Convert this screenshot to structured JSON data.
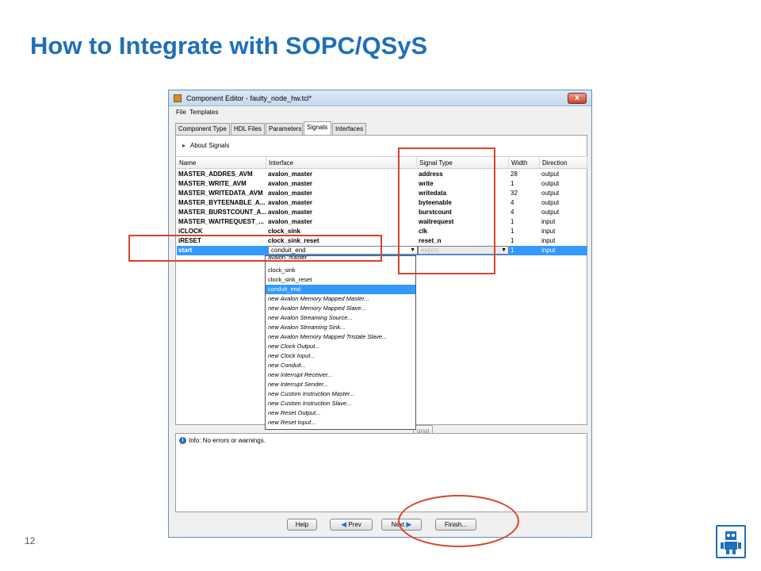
{
  "slide": {
    "title": "How to Integrate with SOPC/QSyS",
    "page_number": "12",
    "annotation_color": "#d6452c",
    "title_color": "#1f6fb8"
  },
  "window": {
    "title": "Component Editor - faulty_node_hw.tcl*",
    "close_glyph": "x",
    "menu": [
      "File",
      "Templates"
    ],
    "tabs": [
      "Component Type",
      "HDL Files",
      "Parameters",
      "Signals",
      "Interfaces"
    ],
    "active_tab": "Signals",
    "about_label": "About Signals",
    "columns": [
      "Name",
      "Interface",
      "Signal Type",
      "Width",
      "Direction"
    ],
    "rows": [
      {
        "name": "MASTER_ADDRES_AVM",
        "interface": "avalon_master",
        "signal_type": "address",
        "width": "28",
        "direction": "output"
      },
      {
        "name": "MASTER_WRITE_AVM",
        "interface": "avalon_master",
        "signal_type": "write",
        "width": "1",
        "direction": "output"
      },
      {
        "name": "MASTER_WRITEDATA_AVM",
        "interface": "avalon_master",
        "signal_type": "writedata",
        "width": "32",
        "direction": "output"
      },
      {
        "name": "MASTER_BYTEENABLE_A...",
        "interface": "avalon_master",
        "signal_type": "byteenable",
        "width": "4",
        "direction": "output"
      },
      {
        "name": "MASTER_BURSTCOUNT_A...",
        "interface": "avalon_master",
        "signal_type": "burstcount",
        "width": "4",
        "direction": "output"
      },
      {
        "name": "MASTER_WAITREQUEST_...",
        "interface": "avalon_master",
        "signal_type": "waitrequest",
        "width": "1",
        "direction": "input"
      },
      {
        "name": "iCLOCK",
        "interface": "clock_sink",
        "signal_type": "clk",
        "width": "1",
        "direction": "input"
      },
      {
        "name": "iRESET",
        "interface": "clock_sink_reset",
        "signal_type": "reset_n",
        "width": "1",
        "direction": "input"
      }
    ],
    "selected_row": {
      "name": "start",
      "interface": "conduit_end",
      "signal_type": "export",
      "width": "1",
      "direction": "input"
    },
    "dropdown_options": [
      "avalon_master",
      "clock_sink",
      "clock_sink_reset",
      "conduit_end",
      "new Avalon Memory Mapped Master...",
      "new Avalon Memory Mapped Slave...",
      "new Avalon Streaming Source...",
      "new Avalon Streaming Sink...",
      "new Avalon Memory Mapped Tristate Slave...",
      "new Clock Output...",
      "new Clock Input...",
      "new Conduit...",
      "new Interrupt Receiver...",
      "new Interrupt Sender...",
      "new Custom Instruction Master...",
      "new Custom Instruction Slave...",
      "new Reset Output...",
      "new Reset Input..."
    ],
    "highlighted_option": "conduit_end",
    "partial_button_label": "gnal",
    "message": "Info: No errors or warnings.",
    "buttons": {
      "help": "Help",
      "prev": "Prev",
      "next": "Next",
      "finish": "Finish..."
    }
  }
}
